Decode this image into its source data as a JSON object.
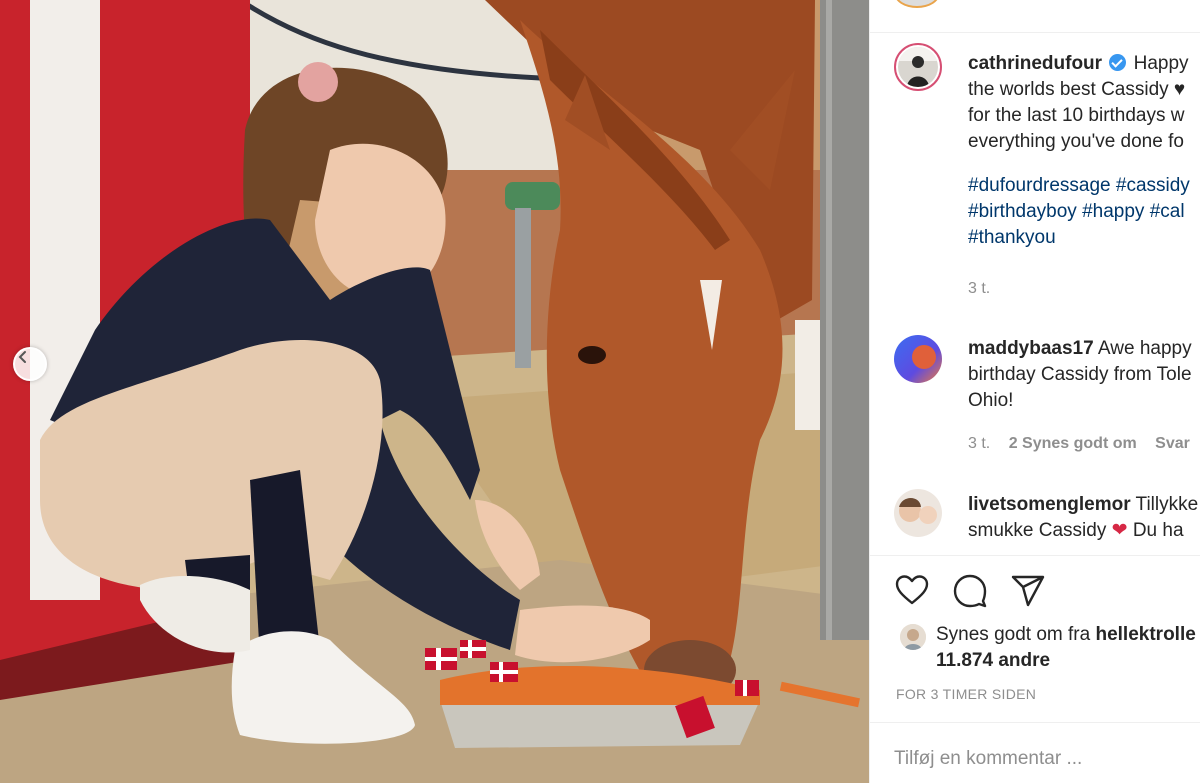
{
  "post": {
    "author": "cathrinedufour",
    "caption_lines": [
      "Happy",
      "the worlds best Cassidy ♥",
      "for the last 10 birthdays w",
      "everything you've done fo"
    ],
    "hashtag_lines": [
      "#dufourdressage #cassidy",
      "#birthdayboy #happy #cal",
      "#thankyou"
    ],
    "time": "3 t."
  },
  "comments": [
    {
      "user": "maddybaas17",
      "lines": [
        "Awe happy",
        "birthday Cassidy from Tole",
        "Ohio!"
      ],
      "time": "3 t.",
      "likes": "2 Synes godt om",
      "reply": "Svar"
    },
    {
      "user": "livetsomenglemor",
      "lines": [
        "Tillykke",
        "smukke Cassidy",
        "Du ha"
      ]
    }
  ],
  "actions": {
    "like": "heart-icon",
    "comment": "comment-icon",
    "share": "share-icon"
  },
  "likes": {
    "prefix": "Synes godt om fra",
    "user": "hellektrolle",
    "count": "11.874 andre"
  },
  "timestamp": "FOR 3 TIMER SIDEN",
  "add_comment_placeholder": "Tilføj en kommentar ...",
  "colors": {
    "hashtag": "#00376b",
    "verified": "#3897f0",
    "meta": "#8e8e8e"
  }
}
